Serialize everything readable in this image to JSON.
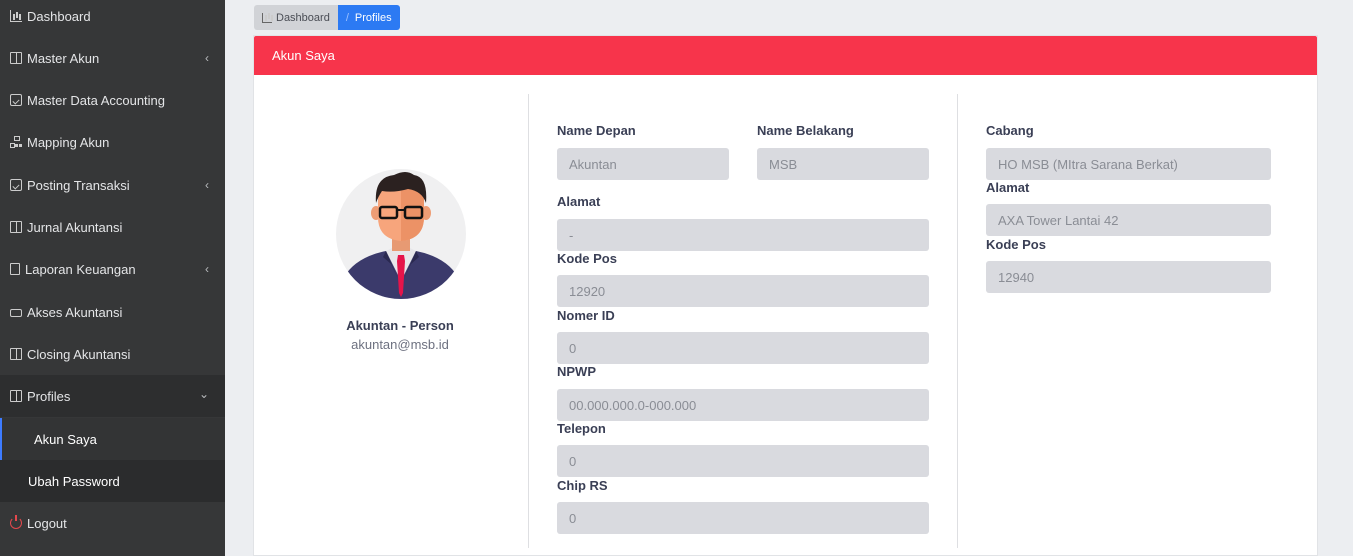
{
  "sidebar": {
    "items": [
      {
        "label": "Dashboard",
        "icon": "chart-icon"
      },
      {
        "label": "Master Akun",
        "icon": "book-icon",
        "chevron": "‹"
      },
      {
        "label": "Master Data Accounting",
        "icon": "calendar-check-icon"
      },
      {
        "label": "Mapping Akun",
        "icon": "sitemap-icon"
      },
      {
        "label": "Posting Transaksi",
        "icon": "calendar-check-icon",
        "chevron": "‹"
      },
      {
        "label": "Jurnal Akuntansi",
        "icon": "journal-icon"
      },
      {
        "label": "Laporan Keuangan",
        "icon": "document-icon",
        "chevron": "‹"
      },
      {
        "label": "Akses Akuntansi",
        "icon": "car-icon"
      },
      {
        "label": "Closing Akuntansi",
        "icon": "journal-icon"
      },
      {
        "label": "Profiles",
        "icon": "book-icon",
        "chevron": "⌄"
      }
    ],
    "sub_items": [
      {
        "label": "Akun Saya",
        "active": true
      },
      {
        "label": "Ubah Password",
        "active": false
      }
    ],
    "logout": {
      "label": "Logout",
      "icon": "power-icon"
    }
  },
  "breadcrumb": {
    "home": "Dashboard",
    "separator": "/",
    "current": "Profiles"
  },
  "card": {
    "title": "Akun Saya",
    "header_color": "#f7344b"
  },
  "profile": {
    "name": "Akuntan - Person",
    "email": "akuntan@msb.id"
  },
  "form": {
    "name_depan": {
      "label": "Name Depan",
      "placeholder": "Akuntan"
    },
    "name_belakang": {
      "label": "Name Belakang",
      "placeholder": "MSB"
    },
    "alamat": {
      "label": "Alamat",
      "placeholder": "-"
    },
    "kode_pos": {
      "label": "Kode Pos",
      "placeholder": "12920"
    },
    "nomer_id": {
      "label": "Nomer ID",
      "placeholder": "0"
    },
    "npwp": {
      "label": "NPWP",
      "placeholder": "00.000.000.0-000.000"
    },
    "telepon": {
      "label": "Telepon",
      "placeholder": "0"
    },
    "chip_rs": {
      "label": "Chip RS",
      "placeholder": "0"
    }
  },
  "branch": {
    "cabang": {
      "label": "Cabang",
      "placeholder": "HO MSB (MItra Sarana Berkat)"
    },
    "alamat": {
      "label": "Alamat",
      "placeholder": "AXA Tower Lantai 42"
    },
    "kode_pos": {
      "label": "Kode Pos",
      "placeholder": "12940"
    }
  },
  "colors": {
    "sidebar_bg": "#363738",
    "accent_blue": "#2c7af3",
    "header_red": "#f7344b",
    "input_bg": "#d9dadf"
  }
}
